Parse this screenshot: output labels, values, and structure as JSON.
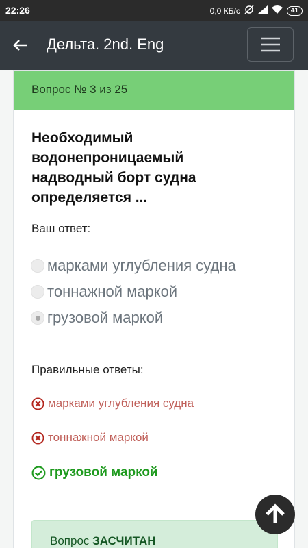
{
  "status_bar": {
    "time": "22:26",
    "network_speed": "0,0 КБ/с",
    "battery": "41"
  },
  "app_bar": {
    "back_icon": "arrow-left-icon",
    "title": "Дельта. 2nd. Eng",
    "menu_icon": "hamburger-menu-icon"
  },
  "card": {
    "header": "Вопрос № 3 из 25",
    "question": "Необходимый водонепроницаемый надводный борт судна определяется ...",
    "your_answer_label": "Ваш ответ:",
    "options": [
      {
        "label": "марками углубления судна",
        "selected": false
      },
      {
        "label": "тоннажной маркой",
        "selected": false
      },
      {
        "label": "грузовой маркой",
        "selected": true
      }
    ],
    "correct_title": "Правильные ответы:",
    "results": [
      {
        "label": "марками углубления судна",
        "status": "wrong",
        "icon": "x-circle-icon"
      },
      {
        "label": "тоннажной маркой",
        "status": "wrong",
        "icon": "x-circle-icon"
      },
      {
        "label": "грузовой маркой",
        "status": "correct",
        "icon": "check-circle-icon"
      }
    ],
    "verdict_prefix": "Вопрос",
    "verdict_value": "ЗАСЧИТАН"
  },
  "colors": {
    "header_green": "#77cf77",
    "app_bar": "#343a40",
    "wrong": "#c0605a",
    "correct": "#1e9a1e"
  }
}
